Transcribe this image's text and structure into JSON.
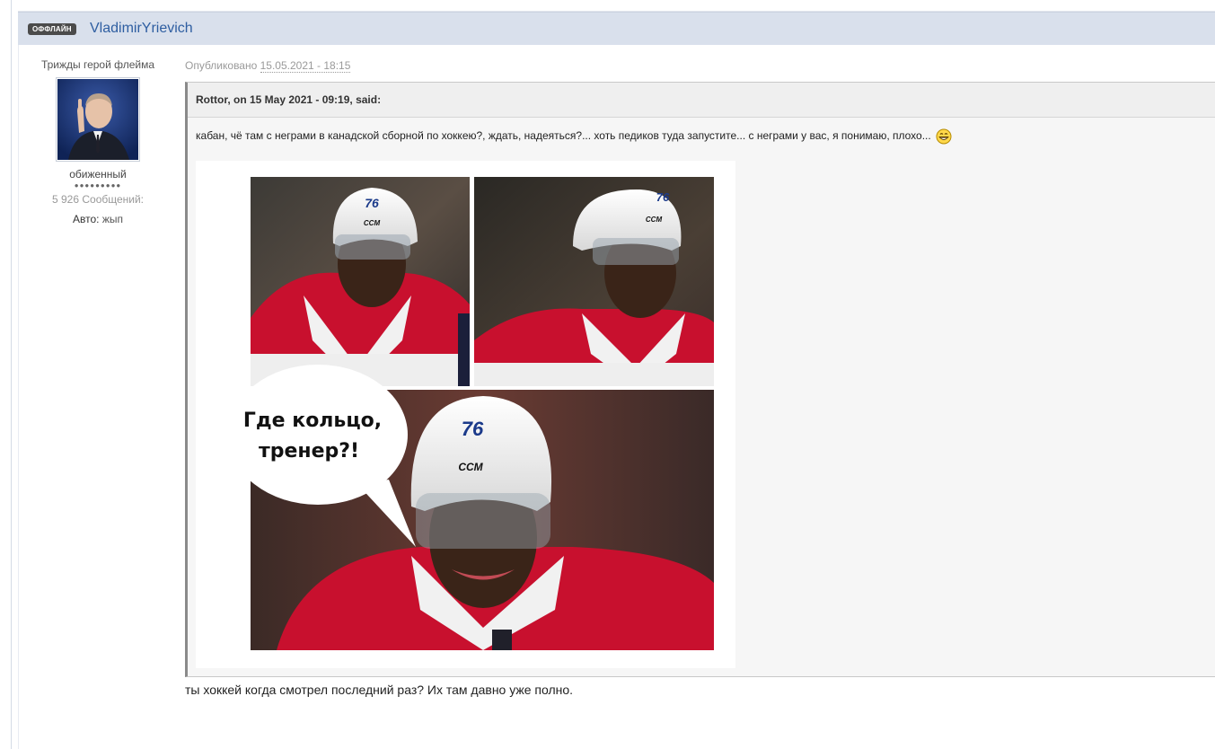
{
  "header": {
    "status_badge": "ОФФЛАЙН",
    "author_name": "VladimirYrievich"
  },
  "author": {
    "user_title": "Трижды герой флейма",
    "group": "обиженный",
    "pips": "●●●●●●●●●",
    "post_count": "5 926 Сообщений:",
    "car_label": "Авто:",
    "car_value": "жып"
  },
  "post": {
    "published_label": "Опубликовано",
    "published_date": "15.05.2021 - 18:15",
    "quote": {
      "citation": "Rottor, on 15 May 2021 - 09:19, said:",
      "text": "кабан, чё там с неграми в канадской сборной по хоккею?, ждать, надеяться?... хоть педиков туда запустите... с неграми у вас, я понимаю, плохо...",
      "smiley_icon": "grin-smiley-icon",
      "image": {
        "speech_bubble_line1": "Где кольцо,",
        "speech_bubble_line2": "тренер?!",
        "helmet_number": "76",
        "helmet_brand": "CCM"
      }
    },
    "reply": "ты хоккей когда смотрел последний раз? Их там давно уже полно."
  },
  "colors": {
    "header_bg": "#d9e0ec",
    "author_link": "#2e5ea1",
    "badge_bg": "#4b4b4b",
    "jersey_red": "#c8102e"
  }
}
